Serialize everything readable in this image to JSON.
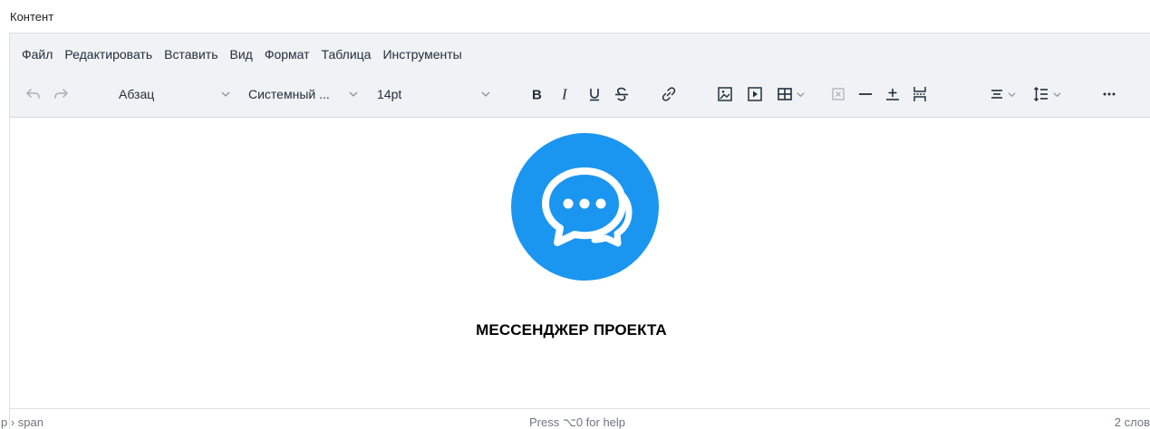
{
  "field_label": "Контент",
  "menubar": {
    "items": [
      {
        "label": "Файл"
      },
      {
        "label": "Редактировать"
      },
      {
        "label": "Вставить"
      },
      {
        "label": "Вид"
      },
      {
        "label": "Формат"
      },
      {
        "label": "Таблица"
      },
      {
        "label": "Инструменты"
      }
    ]
  },
  "toolbar": {
    "block_format": "Абзац",
    "font_family": "Системный ...",
    "font_size": "14pt",
    "icons": [
      "undo-icon",
      "redo-icon",
      "bold-icon",
      "italic-icon",
      "underline-icon",
      "strikethrough-icon",
      "link-icon",
      "image-icon",
      "media-icon",
      "table-icon",
      "remove-format-icon",
      "horizontal-rule-icon",
      "insert-anchor-icon",
      "page-break-icon",
      "align-icon",
      "line-height-icon",
      "more-icon"
    ]
  },
  "content": {
    "logo_icon": "chat-bubbles-icon",
    "logo_color": "#1a96f0",
    "title": "МЕССЕНДЖЕР ПРОЕКТА"
  },
  "statusbar": {
    "path": "p › span",
    "help": "Press ⌥0 for help",
    "word_count": "2 слов"
  }
}
